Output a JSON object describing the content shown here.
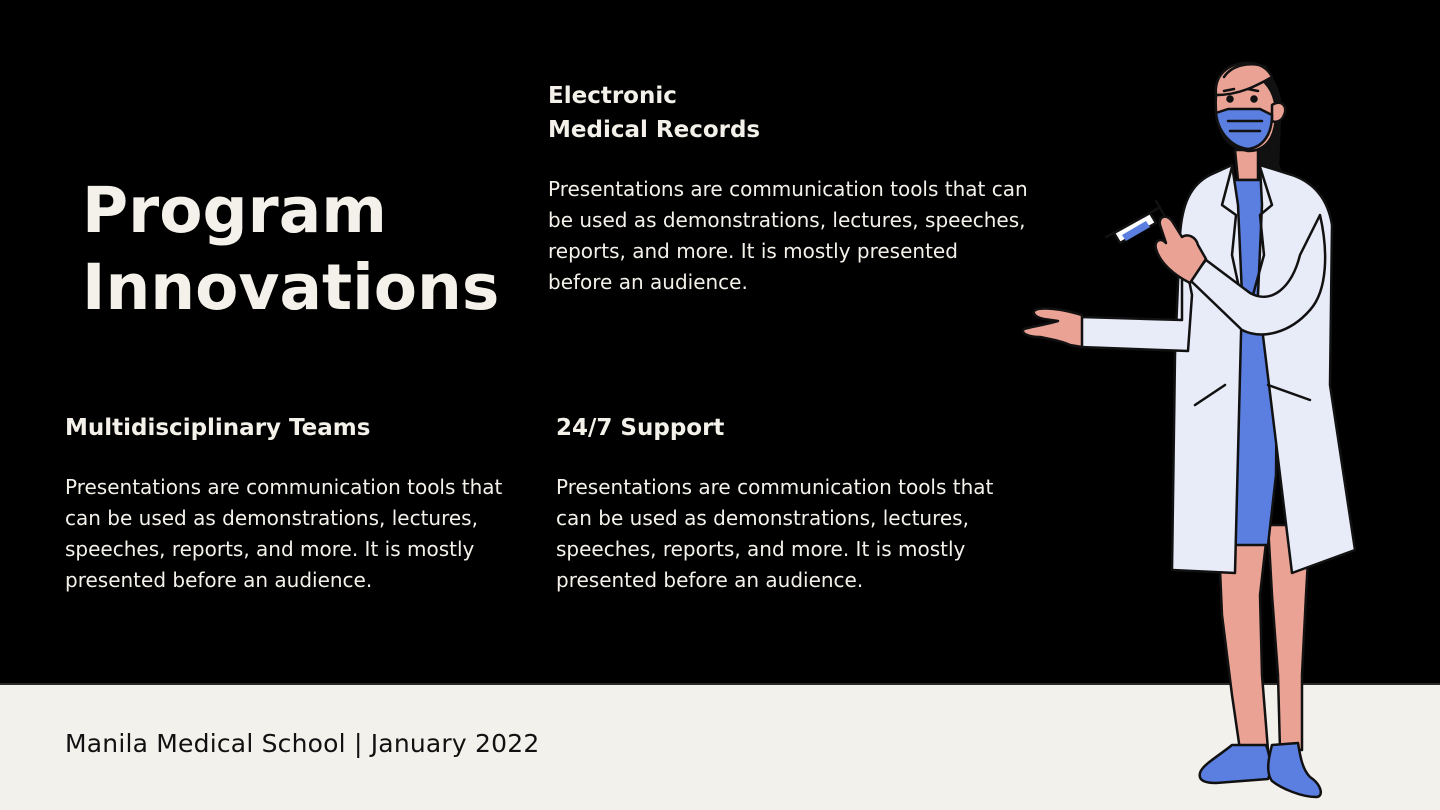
{
  "slide": {
    "title_line1": "Program",
    "title_line2": "Innovations",
    "blocks": [
      {
        "heading_line1": "Electronic",
        "heading_line2": "Medical Records",
        "body": "Presentations are communication tools that can be used as demonstrations, lectures, speeches, reports, and more. It is mostly presented before an audience."
      },
      {
        "heading": "Multidisciplinary Teams",
        "body": "Presentations are communication tools that can be used as demonstrations, lectures, speeches, reports, and more. It is mostly presented before an audience."
      },
      {
        "heading": "24/7 Support",
        "body": "Presentations are communication tools that can be used as demonstrations, lectures, speeches, reports, and more. It is mostly presented before an audience."
      }
    ],
    "footer": "Manila Medical School  |  January 2022"
  },
  "illustration": {
    "icon": "doctor-with-syringe-illustration"
  },
  "colors": {
    "background": "#000000",
    "footer_band": "#f3f1ec",
    "text_light": "#f4f1ea",
    "scrubs_blue": "#5b7fe0",
    "coat": "#e8ebf8",
    "skin": "#e9a294"
  }
}
